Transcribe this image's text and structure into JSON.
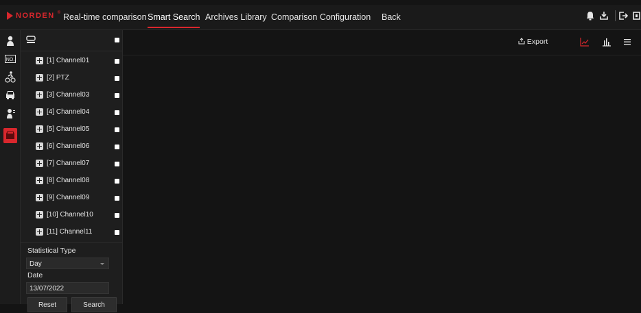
{
  "brand": {
    "name": "NORDEN",
    "mark": "®",
    "accent": "#d9272d"
  },
  "nav": {
    "items": [
      {
        "label": "Real-time comparison",
        "active": false
      },
      {
        "label": "Smart Search",
        "active": true
      },
      {
        "label": "Archives Library",
        "active": false
      },
      {
        "label": "Comparison Configuration",
        "active": false
      },
      {
        "label": "Back",
        "active": false
      }
    ]
  },
  "top_icons": [
    "bell-icon",
    "download-icon",
    "logout-icon",
    "screen-icon"
  ],
  "side_icons": [
    "person-icon",
    "license-plate-icon",
    "cyclist-icon",
    "car-icon",
    "person-search-icon",
    "traffic-alert-icon"
  ],
  "channels": [
    "[1] Channel01",
    "[2] PTZ",
    "[3] Channel03",
    "[4] Channel04",
    "[5] Channel05",
    "[6] Channel06",
    "[7] Channel07",
    "[8] Channel08",
    "[9] Channel09",
    "[10] Channel10",
    "[11] Channel11"
  ],
  "form": {
    "statistical_type_label": "Statistical Type",
    "statistical_type_value": "Day",
    "date_label": "Date",
    "date_value": "13/07/2022",
    "reset_label": "Reset",
    "search_label": "Search"
  },
  "toolbar": {
    "export_label": "Export",
    "views": [
      "line-chart-icon",
      "bar-chart-icon",
      "list-icon"
    ],
    "active_view": "line-chart-icon"
  }
}
